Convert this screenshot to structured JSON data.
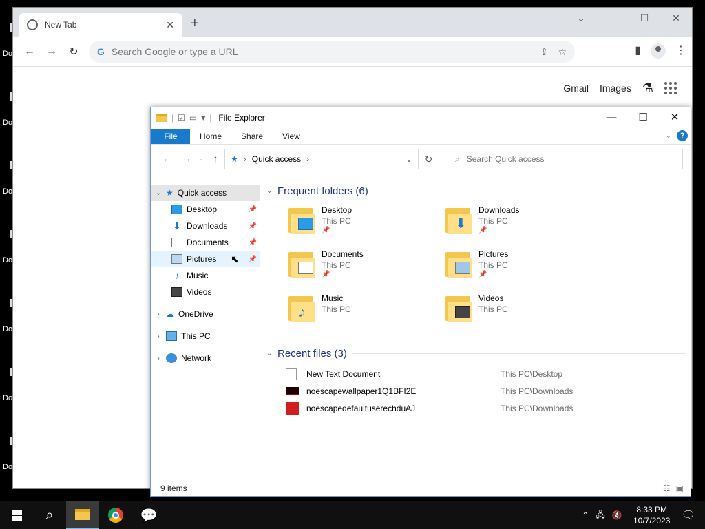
{
  "desktop": {
    "icons": [
      {
        "label": "Do"
      },
      {
        "label": "Do"
      },
      {
        "label": "Do"
      },
      {
        "label": "Do"
      },
      {
        "label": "Do"
      },
      {
        "label": "Do"
      },
      {
        "label": "Do"
      }
    ]
  },
  "chrome": {
    "tab_title": "New Tab",
    "omnibox_placeholder": "Search Google or type a URL",
    "ntp_links": {
      "gmail": "Gmail",
      "images": "Images"
    }
  },
  "explorer": {
    "title": "File Explorer",
    "ribbon": {
      "file": "File",
      "home": "Home",
      "share": "Share",
      "view": "View"
    },
    "address": "Quick access",
    "search_placeholder": "Search Quick access",
    "nav": {
      "quick_access": "Quick access",
      "quick_items": [
        "Desktop",
        "Downloads",
        "Documents",
        "Pictures",
        "Music",
        "Videos"
      ],
      "onedrive": "OneDrive",
      "this_pc": "This PC",
      "network": "Network"
    },
    "frequent_header": "Frequent folders (6)",
    "folders": [
      {
        "name": "Desktop",
        "loc": "This PC"
      },
      {
        "name": "Downloads",
        "loc": "This PC"
      },
      {
        "name": "Documents",
        "loc": "This PC"
      },
      {
        "name": "Pictures",
        "loc": "This PC"
      },
      {
        "name": "Music",
        "loc": "This PC"
      },
      {
        "name": "Videos",
        "loc": "This PC"
      }
    ],
    "recent_header": "Recent files (3)",
    "recent": [
      {
        "name": "New Text Document",
        "loc": "This PC\\Desktop"
      },
      {
        "name": "noescapewallpaper1Q1BFI2E",
        "loc": "This PC\\Downloads"
      },
      {
        "name": "noescapedefaultuserechduAJ",
        "loc": "This PC\\Downloads"
      }
    ],
    "status": "9 items"
  },
  "taskbar": {
    "time": "8:33 PM",
    "date": "10/7/2023"
  },
  "colors": {
    "accent": "#1979ca",
    "folder": "#f3c74d",
    "header_blue": "#1e3287"
  }
}
